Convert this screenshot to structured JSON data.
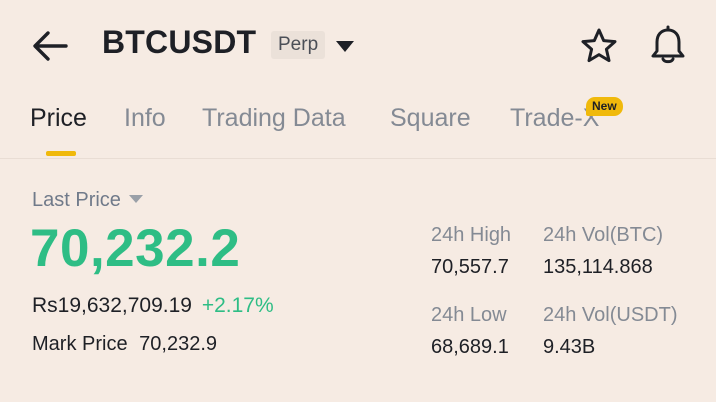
{
  "header": {
    "symbol": "BTCUSDT",
    "contract_type": "Perp",
    "icons": [
      "back-arrow-icon",
      "dropdown-caret-icon",
      "star-icon",
      "bell-icon"
    ]
  },
  "tabs": [
    {
      "label": "Price",
      "active": true
    },
    {
      "label": "Info",
      "active": false
    },
    {
      "label": "Trading Data",
      "active": false
    },
    {
      "label": "Square",
      "active": false
    },
    {
      "label": "Trade-X",
      "active": false,
      "badge": "New"
    }
  ],
  "price": {
    "last_price_label": "Last Price",
    "last_price": "70,232.2",
    "fiat_value": "Rs19,632,709.19",
    "change_percent": "+2.17%",
    "mark_price_label": "Mark Price",
    "mark_price": "70,232.9"
  },
  "stats": {
    "high_24h_label": "24h High",
    "high_24h": "70,557.7",
    "vol_btc_label": "24h Vol(BTC)",
    "vol_btc": "135,114.868",
    "low_24h_label": "24h Low",
    "low_24h": "68,689.1",
    "vol_usdt_label": "24h Vol(USDT)",
    "vol_usdt": "9.43B"
  },
  "colors": {
    "background": "#f6ebe3",
    "accent": "#f0b90b",
    "positive": "#2ebd85",
    "text_primary": "#1e2026",
    "text_secondary": "#848a94"
  }
}
